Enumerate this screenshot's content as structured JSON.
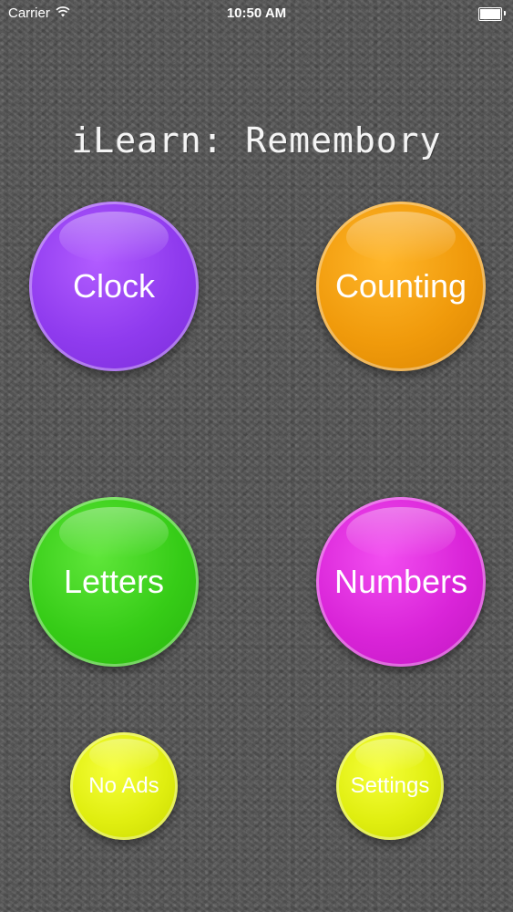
{
  "status_bar": {
    "carrier": "Carrier",
    "wifi_icon": "wifi-icon",
    "time": "10:50 AM",
    "battery_icon": "battery-icon"
  },
  "app": {
    "title": "iLearn: Remembory"
  },
  "menu": {
    "clock": {
      "label": "Clock",
      "color": "#8f3bee"
    },
    "counting": {
      "label": "Counting",
      "color": "#f09a0b"
    },
    "letters": {
      "label": "Letters",
      "color": "#36cc17"
    },
    "numbers": {
      "label": "Numbers",
      "color": "#d924d8"
    },
    "no_ads": {
      "label": "No Ads",
      "color": "#e0ee10"
    },
    "settings": {
      "label": "Settings",
      "color": "#e0ee10"
    }
  },
  "colors": {
    "background": "#555555",
    "text": "#ffffff"
  }
}
